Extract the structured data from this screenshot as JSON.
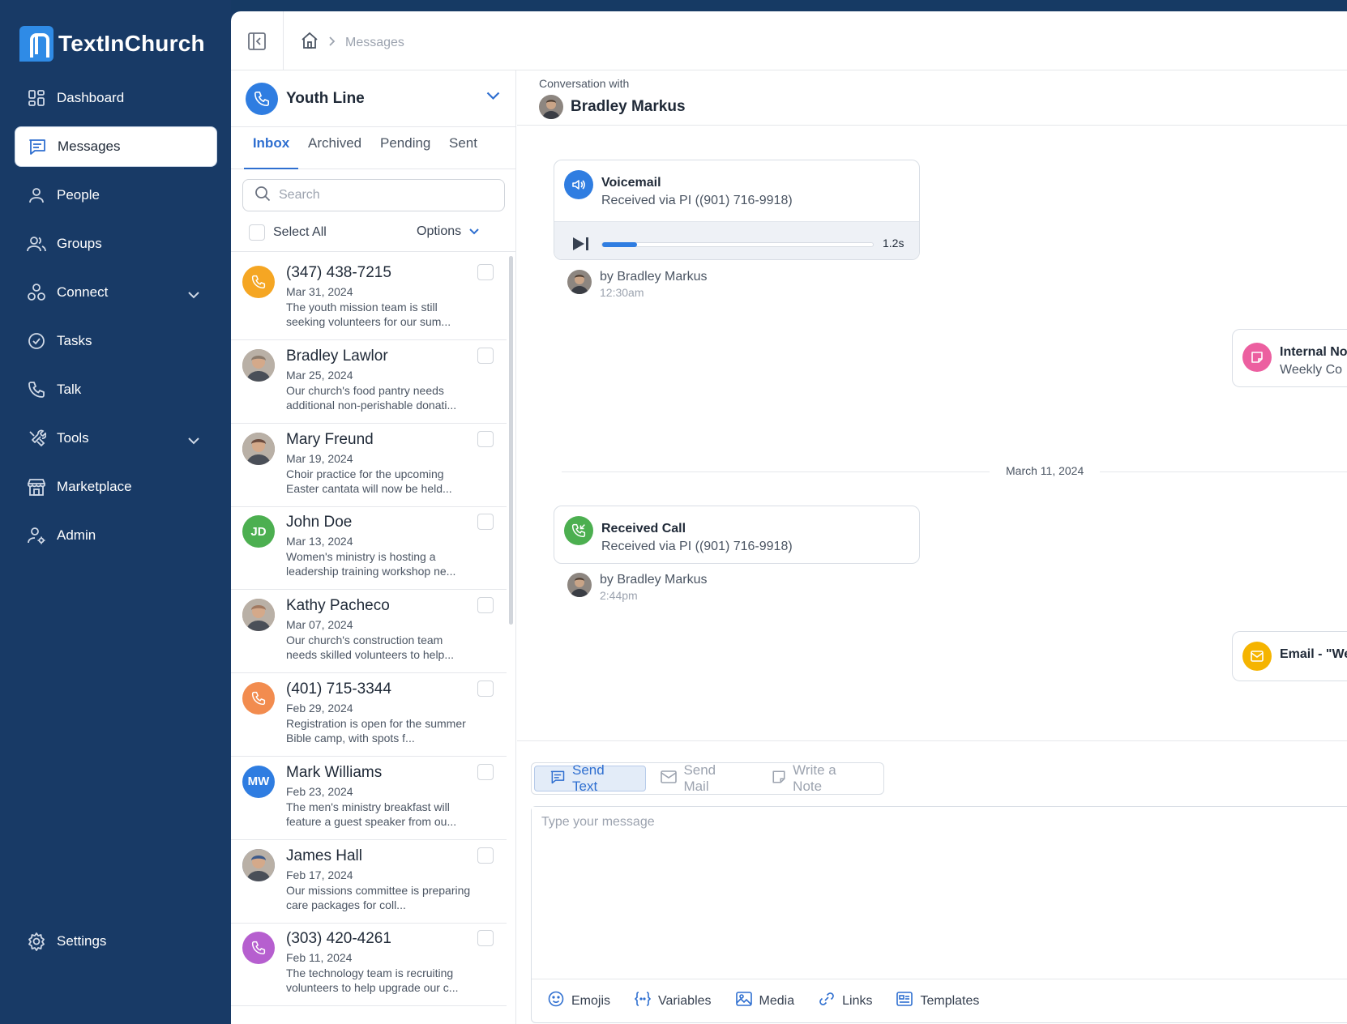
{
  "app": {
    "brand": "TextInChurch"
  },
  "sidebar": {
    "items": [
      {
        "label": "Dashboard",
        "icon": "dashboard-icon"
      },
      {
        "label": "Messages",
        "icon": "messages-icon",
        "active": true
      },
      {
        "label": "People",
        "icon": "person-icon"
      },
      {
        "label": "Groups",
        "icon": "groups-icon"
      },
      {
        "label": "Connect",
        "icon": "connect-icon",
        "expandable": true
      },
      {
        "label": "Tasks",
        "icon": "check-circle-icon"
      },
      {
        "label": "Talk",
        "icon": "phone-icon"
      },
      {
        "label": "Tools",
        "icon": "tools-icon",
        "expandable": true
      },
      {
        "label": "Marketplace",
        "icon": "store-icon"
      },
      {
        "label": "Admin",
        "icon": "admin-icon"
      }
    ],
    "settings_label": "Settings"
  },
  "breadcrumb": {
    "current": "Messages"
  },
  "line": {
    "name": "Youth Line"
  },
  "tabs": [
    "Inbox",
    "Archived",
    "Pending",
    "Sent"
  ],
  "search": {
    "placeholder": "Search",
    "value": ""
  },
  "select_all_label": "Select All",
  "options_label": "Options",
  "conversations": [
    {
      "name": "(347) 438-7215",
      "date": "Mar 31, 2024",
      "preview": "The youth mission team is still seeking volunteers for our sum...",
      "avatar_type": "icon",
      "color": "#f5a623"
    },
    {
      "name": "Bradley Lawlor",
      "date": "Mar 25, 2024",
      "preview": "Our church's food pantry needs additional non-perishable donati...",
      "avatar_type": "photo",
      "color": "#8a7a6c"
    },
    {
      "name": "Mary Freund",
      "date": "Mar 19, 2024",
      "preview": "Choir practice for the upcoming Easter cantata will now be held...",
      "avatar_type": "photo",
      "color": "#6b4b3e"
    },
    {
      "name": "John Doe",
      "date": "Mar 13, 2024",
      "preview": "Women's ministry is hosting a leadership training workshop ne...",
      "avatar_type": "initials",
      "initials": "JD",
      "color": "#4caf50"
    },
    {
      "name": "Kathy Pacheco",
      "date": "Mar 07, 2024",
      "preview": "Our church's construction team needs skilled volunteers to help...",
      "avatar_type": "photo",
      "color": "#a07860"
    },
    {
      "name": "(401) 715-3344",
      "date": "Feb 29, 2024",
      "preview": "Registration is open for the summer Bible camp, with spots f...",
      "avatar_type": "icon",
      "color": "#f28c4f"
    },
    {
      "name": "Mark Williams",
      "date": "Feb 23, 2024",
      "preview": "The men's ministry breakfast will feature a guest speaker from ou...",
      "avatar_type": "initials",
      "initials": "MW",
      "color": "#2f7de1"
    },
    {
      "name": "James Hall",
      "date": "Feb 17, 2024",
      "preview": "Our missions committee is preparing care packages for coll...",
      "avatar_type": "photo",
      "color": "#3d5a8a"
    },
    {
      "name": "(303) 420-4261",
      "date": "Feb 11, 2024",
      "preview": "The technology team is recruiting volunteers to help upgrade our c...",
      "avatar_type": "icon",
      "color": "#b65fcf"
    }
  ],
  "conversation": {
    "label": "Conversation with",
    "contact": "Bradley Markus",
    "events": [
      {
        "type": "voicemail",
        "title": "Voicemail",
        "subtitle": "Received via PI ((901) 716-9918)",
        "duration": "1.2s",
        "progress": 0.13,
        "by": "by Bradley Markus",
        "time": "12:30am",
        "color": "#2f7de1"
      },
      {
        "type": "note",
        "title": "Internal Note",
        "subtitle": "Weekly Co",
        "color": "#ec5fa0"
      },
      {
        "type": "date",
        "label": "March 11, 2024"
      },
      {
        "type": "call",
        "title": "Received Call",
        "subtitle": "Received via PI ((901) 716-9918)",
        "by": "by Bradley Markus",
        "time": "2:44pm",
        "color": "#4caf50"
      },
      {
        "type": "email",
        "title": "Email - \"We",
        "color": "#f5b400"
      }
    ]
  },
  "composer": {
    "tabs": [
      "Send Text",
      "Send Mail",
      "Write a Note"
    ],
    "placeholder": "Type your message",
    "tools": [
      "Emojis",
      "Variables",
      "Media",
      "Links",
      "Templates"
    ]
  },
  "colors": {
    "sidebar": "#183a66",
    "accent": "#2f7de1",
    "active_tab": "#2f6fd0"
  }
}
